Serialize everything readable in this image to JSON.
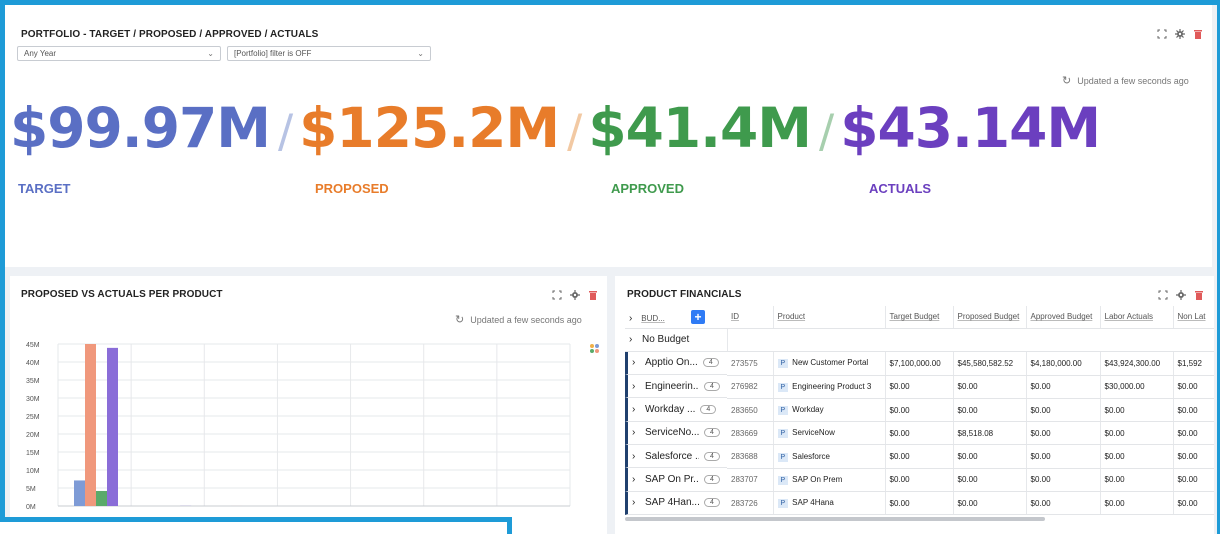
{
  "top": {
    "title": "PORTFOLIO - TARGET / PROPOSED / APPROVED / ACTUALS",
    "year_select": "Any Year",
    "filter_select": "[Portfolio] filter is OFF",
    "updated": "Updated a few seconds ago",
    "kpis": [
      {
        "value": "$99.97M",
        "label": "TARGET",
        "color": "#5a6fc4"
      },
      {
        "value": "$125.2M",
        "label": "PROPOSED",
        "color": "#e87c2a"
      },
      {
        "value": "$41.4M",
        "label": "APPROVED",
        "color": "#3f9a4d"
      },
      {
        "value": "$43.14M",
        "label": "ACTUALS",
        "color": "#6b3fbf"
      }
    ],
    "slash": "/",
    "slash_colors": [
      "#b7c3e4",
      "#f2c9a3",
      "#a7cfae"
    ]
  },
  "chart_panel": {
    "title": "PROPOSED VS ACTUALS PER PRODUCT",
    "updated": "Updated a few seconds ago",
    "chart_data": {
      "type": "bar",
      "y_ticks": [
        "45M",
        "40M",
        "35M",
        "30M",
        "25M",
        "20M",
        "15M",
        "10M",
        "5M",
        "0M"
      ],
      "ylim": [
        0,
        45000000
      ],
      "series": [
        {
          "color": "#7e9bd6",
          "values": [
            7100000,
            0,
            0,
            0,
            0,
            0,
            0
          ]
        },
        {
          "color": "#f0987c",
          "values": [
            45580582,
            0,
            8518,
            0,
            0,
            0,
            0
          ]
        },
        {
          "color": "#5aaa6a",
          "values": [
            4180000,
            0,
            0,
            0,
            0,
            0,
            0
          ]
        },
        {
          "color": "#8a6dd8",
          "values": [
            43924300,
            30000,
            0,
            0,
            0,
            0,
            0
          ]
        }
      ]
    }
  },
  "table_panel": {
    "title": "PRODUCT FINANCIALS",
    "headers": {
      "group": "BUD...",
      "id": "ID",
      "product": "Product",
      "target": "Target Budget",
      "proposed": "Proposed Budget",
      "approved": "Approved Budget",
      "labor": "Labor Actuals",
      "nonlabor": "Non Lat"
    },
    "no_budget": "No Budget",
    "rows": [
      {
        "group": "Apptio On...",
        "count": "4",
        "id": "273575",
        "product": "New Customer Portal",
        "target": "$7,100,000.00",
        "proposed": "$45,580,582.52",
        "approved": "$4,180,000.00",
        "labor": "$43,924,300.00",
        "nonlabor": "$1,592"
      },
      {
        "group": "Engineerin...",
        "count": "4",
        "id": "276982",
        "product": "Engineering Product 3",
        "target": "$0.00",
        "proposed": "$0.00",
        "approved": "$0.00",
        "labor": "$30,000.00",
        "nonlabor": "$0.00"
      },
      {
        "group": "Workday ...",
        "count": "4",
        "id": "283650",
        "product": "Workday",
        "target": "$0.00",
        "proposed": "$0.00",
        "approved": "$0.00",
        "labor": "$0.00",
        "nonlabor": "$0.00"
      },
      {
        "group": "ServiceNo...",
        "count": "4",
        "id": "283669",
        "product": "ServiceNow",
        "target": "$0.00",
        "proposed": "$8,518.08",
        "approved": "$0.00",
        "labor": "$0.00",
        "nonlabor": "$0.00"
      },
      {
        "group": "Salesforce ...",
        "count": "4",
        "id": "283688",
        "product": "Salesforce",
        "target": "$0.00",
        "proposed": "$0.00",
        "approved": "$0.00",
        "labor": "$0.00",
        "nonlabor": "$0.00"
      },
      {
        "group": "SAP On Pr...",
        "count": "4",
        "id": "283707",
        "product": "SAP On Prem",
        "target": "$0.00",
        "proposed": "$0.00",
        "approved": "$0.00",
        "labor": "$0.00",
        "nonlabor": "$0.00"
      },
      {
        "group": "SAP 4Han...",
        "count": "4",
        "id": "283726",
        "product": "SAP 4Hana",
        "target": "$0.00",
        "proposed": "$0.00",
        "approved": "$0.00",
        "labor": "$0.00",
        "nonlabor": "$0.00"
      }
    ],
    "badge": "P",
    "caret": "›"
  }
}
